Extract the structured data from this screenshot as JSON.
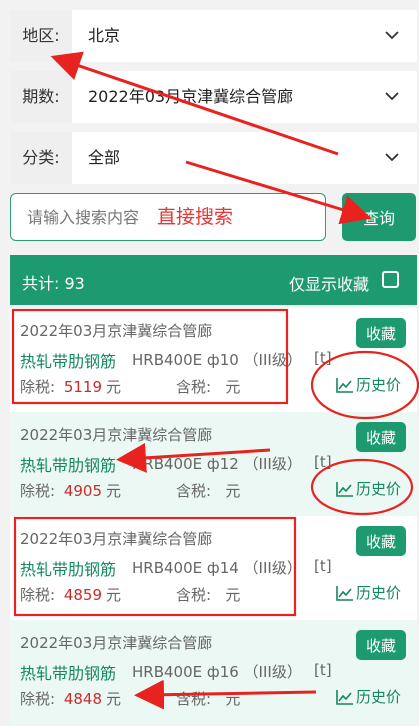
{
  "filters": {
    "region": {
      "label": "地区:",
      "value": "北京"
    },
    "period": {
      "label": "期数:",
      "value": "2022年03月京津冀综合管廊"
    },
    "category": {
      "label": "分类:",
      "value": "全部"
    }
  },
  "search": {
    "placeholder": "请输入搜索内容",
    "note": "直接搜索",
    "button": "查询"
  },
  "list": {
    "count_label": "共计: 93",
    "fav_only_label": "仅显示收藏",
    "items": [
      {
        "title": "2022年03月京津冀综合管廊",
        "name": "热轧带肋钢筋",
        "spec": "HRB400E ф10 （III级）",
        "unit": "[t]",
        "ex_label": "除税:",
        "ex_price": "5119",
        "currency": "元",
        "inc_label": "含税:",
        "inc_price": "元",
        "fav": "收藏",
        "history": "历史价"
      },
      {
        "title": "2022年03月京津冀综合管廊",
        "name": "热轧带肋钢筋",
        "spec": "HRB400E ф12 （III级）",
        "unit": "[t]",
        "ex_label": "除税:",
        "ex_price": "4905",
        "currency": "元",
        "inc_label": "含税:",
        "inc_price": "元",
        "fav": "收藏",
        "history": "历史价"
      },
      {
        "title": "2022年03月京津冀综合管廊",
        "name": "热轧带肋钢筋",
        "spec": "HRB400E ф14 （III级）",
        "unit": "[t]",
        "ex_label": "除税:",
        "ex_price": "4859",
        "currency": "元",
        "inc_label": "含税:",
        "inc_price": "元",
        "fav": "收藏",
        "history": "历史价"
      },
      {
        "title": "2022年03月京津冀综合管廊",
        "name": "热轧带肋钢筋",
        "spec": "HRB400E ф16 （III级）",
        "unit": "[t]",
        "ex_label": "除税:",
        "ex_price": "4848",
        "currency": "元",
        "inc_label": "含税:",
        "inc_price": "元",
        "fav": "收藏",
        "history": "历史价"
      }
    ]
  },
  "colors": {
    "accent": "#1e9a70",
    "price": "#c82c2c",
    "annotation": "#e53535"
  }
}
